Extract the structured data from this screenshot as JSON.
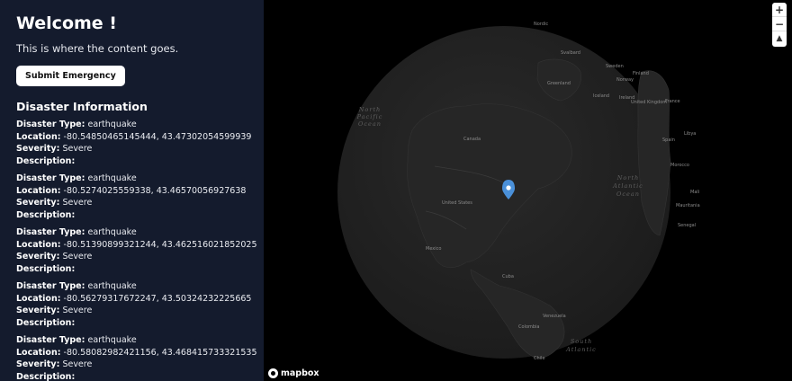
{
  "sidebar": {
    "title": "Welcome !",
    "intro": "This is where the content goes.",
    "submit_label": "Submit Emergency",
    "section_title": "Disaster Information",
    "labels": {
      "type": "Disaster Type:",
      "location": "Location:",
      "severity": "Severity:",
      "description": "Description:"
    },
    "entries": [
      {
        "type": "earthquake",
        "location": "-80.54850465145444, 43.47302054599939",
        "severity": "Severe",
        "description": ""
      },
      {
        "type": "earthquake",
        "location": "-80.5274025559338, 43.46570056927638",
        "severity": "Severe",
        "description": ""
      },
      {
        "type": "earthquake",
        "location": "-80.51390899321244, 43.462516021852025",
        "severity": "Severe",
        "description": ""
      },
      {
        "type": "earthquake",
        "location": "-80.56279317672247, 43.50324232225665",
        "severity": "Severe",
        "description": ""
      },
      {
        "type": "earthquake",
        "location": "-80.58082982421156, 43.468415733321535",
        "severity": "Severe",
        "description": ""
      }
    ]
  },
  "map": {
    "zoom_in": "+",
    "zoom_out": "−",
    "compass": "▲",
    "attribution": "mapbox",
    "marker_color": "#4a90d9",
    "labels": {
      "north_pacific": [
        "North",
        "Pacific",
        "Ocean"
      ],
      "north_atlantic": [
        "North",
        "Atlantic",
        "Ocean"
      ],
      "south_atlantic": [
        "South",
        "Atlantic"
      ],
      "places": {
        "canada": "Canada",
        "united_states": "United States",
        "mexico": "Mexico",
        "cuba": "Cuba",
        "venezuela": "Venezuela",
        "colombia": "Colombia",
        "chile": "Chile",
        "greenland": "Greenland",
        "iceland": "Iceland",
        "svalbard": "Svalbard",
        "sweden": "Sweden",
        "norway": "Norway",
        "finland": "Finland",
        "united_kingdom": "United Kingdom",
        "ireland": "Ireland",
        "france": "France",
        "spain": "Spain",
        "morocco": "Morocco",
        "libya": "Libya",
        "mali": "Mali",
        "mauritania": "Mauritania",
        "senegal": "Senegal",
        "nordic": "Nordic"
      }
    }
  }
}
